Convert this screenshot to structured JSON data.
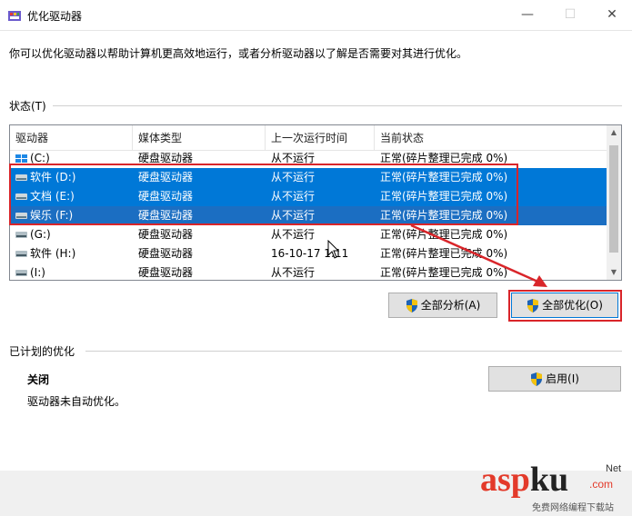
{
  "window": {
    "title": "优化驱动器"
  },
  "intro": "你可以优化驱动器以帮助计算机更高效地运行，或者分析驱动器以了解是否需要对其进行优化。",
  "status": {
    "label": "状态(T)",
    "columns": [
      "驱动器",
      "媒体类型",
      "上一次运行时间",
      "当前状态"
    ],
    "rows": [
      {
        "drive": "(C:)",
        "media": "硬盘驱动器",
        "last_run": "从不运行",
        "state": "正常(碎片整理已完成 0%)",
        "icon": "windows-drive-icon",
        "selected": false
      },
      {
        "drive": "软件 (D:)",
        "media": "硬盘驱动器",
        "last_run": "从不运行",
        "state": "正常(碎片整理已完成 0%)",
        "icon": "drive-icon",
        "selected": true
      },
      {
        "drive": "文档 (E:)",
        "media": "硬盘驱动器",
        "last_run": "从不运行",
        "state": "正常(碎片整理已完成 0%)",
        "icon": "drive-icon",
        "selected": true
      },
      {
        "drive": "娱乐 (F:)",
        "media": "硬盘驱动器",
        "last_run": "从不运行",
        "state": "正常(碎片整理已完成 0%)",
        "icon": "drive-icon",
        "selected": true
      },
      {
        "drive": "(G:)",
        "media": "硬盘驱动器",
        "last_run": "从不运行",
        "state": "正常(碎片整理已完成 0%)",
        "icon": "drive-icon",
        "selected": false
      },
      {
        "drive": "软件 (H:)",
        "media": "硬盘驱动器",
        "last_run": "16-10-17 1:11",
        "state": "正常(碎片整理已完成 0%)",
        "icon": "drive-icon",
        "selected": false
      },
      {
        "drive": "(I:)",
        "media": "硬盘驱动器",
        "last_run": "从不运行",
        "state": "正常(碎片整理已完成 0%)",
        "icon": "drive-icon",
        "selected": false
      }
    ]
  },
  "buttons": {
    "analyze_all": "全部分析(A)",
    "optimize_all": "全部优化(O)",
    "enable": "启用(I)"
  },
  "scheduled": {
    "label": "已计划的优化",
    "state": "关闭",
    "desc": "驱动器未自动优化。"
  },
  "watermark": {
    "text": "asp",
    "text2": "ku",
    "suffix": ".com",
    "tagline": "免费网络编程下载站",
    "net": "Net"
  },
  "colors": {
    "selection": "#0078d7",
    "annotation": "#d9252a"
  }
}
